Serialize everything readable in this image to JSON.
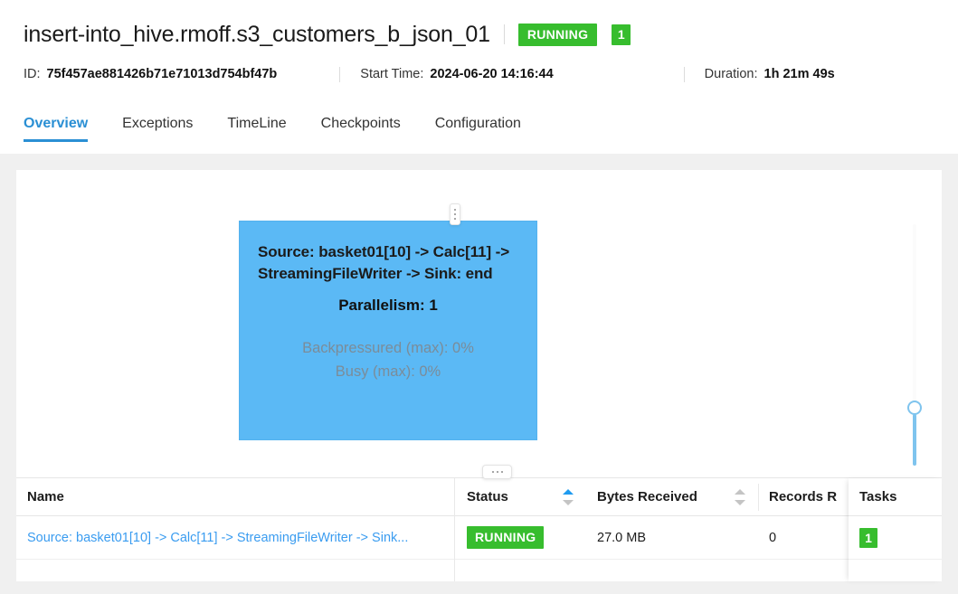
{
  "header": {
    "job_name": "insert-into_hive.rmoff.s3_customers_b_json_01",
    "status_badge": "RUNNING",
    "task_count_badge": "1",
    "id_label": "ID:",
    "id_value": "75f457ae881426b71e71013d754bf47b",
    "start_time_label": "Start Time:",
    "start_time_value": "2024-06-20 14:16:44",
    "duration_label": "Duration:",
    "duration_value": "1h 21m 49s"
  },
  "tabs": [
    {
      "label": "Overview",
      "active": true
    },
    {
      "label": "Exceptions",
      "active": false
    },
    {
      "label": "TimeLine",
      "active": false
    },
    {
      "label": "Checkpoints",
      "active": false
    },
    {
      "label": "Configuration",
      "active": false
    }
  ],
  "graph": {
    "node": {
      "title": "Source: basket01[10] -> Calc[11] -> StreamingFileWriter -> Sink: end",
      "parallelism": "Parallelism: 1",
      "backpressured": "Backpressured (max): 0%",
      "busy": "Busy (max): 0%",
      "fill_color": "#5bb9f5"
    },
    "zoom_slider": {
      "orientation": "vertical",
      "handle_color": "#7fc4ee",
      "filled_track_color": "#7fc4ee",
      "empty_track_color": "#fbfbfb"
    }
  },
  "table": {
    "columns": [
      {
        "key": "name",
        "label": "Name",
        "sortable": false,
        "sort": "none"
      },
      {
        "key": "status",
        "label": "Status",
        "sortable": true,
        "sort": "asc"
      },
      {
        "key": "bytes",
        "label": "Bytes Received",
        "sortable": true,
        "sort": "none"
      },
      {
        "key": "records",
        "label": "Records R",
        "sortable": false,
        "sort": "none"
      },
      {
        "key": "tasks",
        "label": "Tasks",
        "sortable": false,
        "sort": "none"
      }
    ],
    "rows": [
      {
        "name": "Source: basket01[10] -> Calc[11] -> StreamingFileWriter -> Sink...",
        "status": "RUNNING",
        "bytes": "27.0 MB",
        "records": "0",
        "tasks": "1"
      }
    ]
  },
  "colors": {
    "accent_blue": "#2a8fd4",
    "link_blue": "#3a9cf0",
    "status_green": "#37bd2e",
    "node_blue": "#5bb9f5",
    "page_bg": "#f0f0f0"
  }
}
